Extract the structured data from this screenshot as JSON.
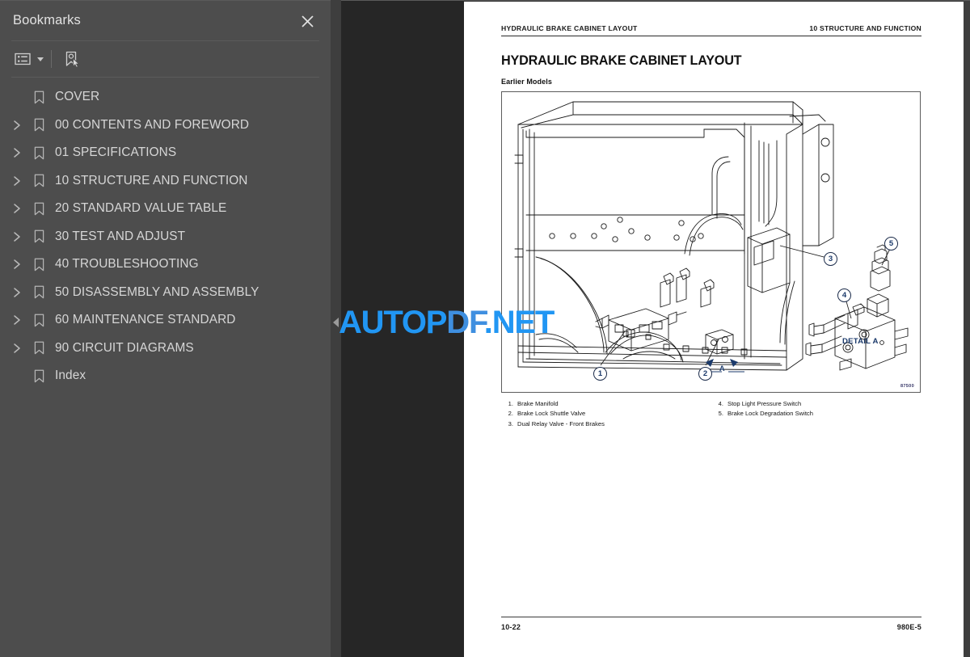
{
  "panel": {
    "title": "Bookmarks",
    "close_icon": "close-icon",
    "toolbar": {
      "options_icon": "list-options-icon",
      "options_caret_icon": "chevron-down-icon",
      "new_bookmark_icon": "new-bookmark-cursor-icon"
    },
    "items": [
      {
        "label": "COVER",
        "expandable": false
      },
      {
        "label": "00 CONTENTS AND FOREWORD",
        "expandable": true
      },
      {
        "label": "01 SPECIFICATIONS",
        "expandable": true
      },
      {
        "label": "10 STRUCTURE AND FUNCTION",
        "expandable": true
      },
      {
        "label": "20 STANDARD VALUE TABLE",
        "expandable": true
      },
      {
        "label": "30 TEST AND ADJUST",
        "expandable": true
      },
      {
        "label": "40 TROUBLESHOOTING",
        "expandable": true
      },
      {
        "label": "50 DISASSEMBLY AND ASSEMBLY",
        "expandable": true
      },
      {
        "label": "60 MAINTENANCE STANDARD",
        "expandable": true
      },
      {
        "label": "90 CIRCUIT DIAGRAMS",
        "expandable": true
      },
      {
        "label": "Index",
        "expandable": false
      }
    ]
  },
  "viewer": {
    "collapse_handle_icon": "collapse-left-icon"
  },
  "document": {
    "running_head_left": "HYDRAULIC BRAKE CABINET LAYOUT",
    "running_head_right": "10 STRUCTURE AND FUNCTION",
    "heading": "HYDRAULIC BRAKE CABINET LAYOUT",
    "subheading": "Earlier Models",
    "figure_number": "87500",
    "detail_label": "DETAIL A",
    "section_marker": "A",
    "callouts": [
      "1",
      "2",
      "3",
      "4",
      "5"
    ],
    "legend_left": [
      {
        "num": "1.",
        "text": "Brake Manifold"
      },
      {
        "num": "2.",
        "text": "Brake Lock Shuttle Valve"
      },
      {
        "num": "3.",
        "text": "Dual Relay Valve - Front Brakes"
      }
    ],
    "legend_right": [
      {
        "num": "4.",
        "text": "Stop Light Pressure Switch"
      },
      {
        "num": "5.",
        "text": "Brake Lock Degradation Switch"
      }
    ],
    "footer_left": "10-22",
    "footer_right": "980E-5"
  },
  "watermark": {
    "part1": "AUTOP",
    "part2": "DF",
    "part3": ".NET"
  },
  "colors": {
    "panel_bg": "#4d4d4d",
    "viewer_bg": "#262626",
    "page_bg": "#ffffff",
    "watermark_blue": "#2196f3",
    "callout_navy": "#1b3a6b"
  }
}
